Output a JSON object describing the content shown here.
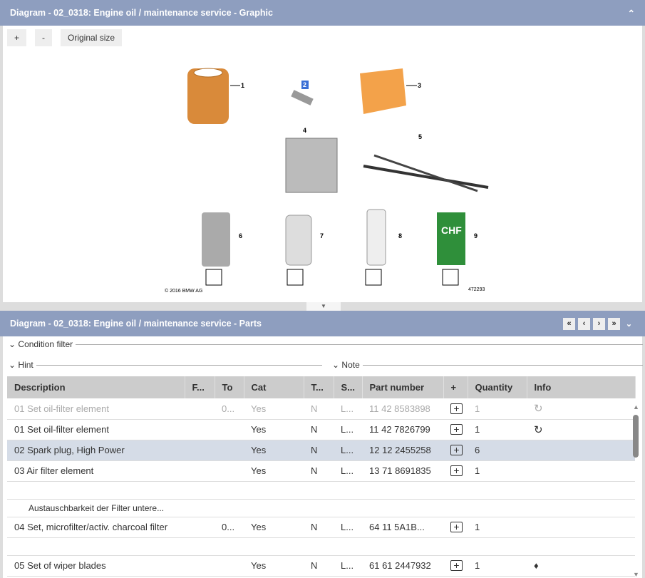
{
  "graphic_panel": {
    "title": "Diagram - 02_0318: Engine oil / maintenance service - Graphic",
    "zoom_in": "+",
    "zoom_out": "-",
    "original_size": "Original size",
    "diagram": {
      "labels": [
        "1",
        "2",
        "3",
        "4",
        "5",
        "6",
        "7",
        "8",
        "9"
      ],
      "copyright": "© 2016 BMW AG",
      "image_id": "472293",
      "product_text": "CHF"
    }
  },
  "parts_panel": {
    "title": "Diagram - 02_0318: Engine oil / maintenance service - Parts",
    "condition_filter": "Condition filter",
    "hint": "Hint",
    "note": "Note",
    "columns": [
      "Description",
      "F...",
      "To",
      "Cat",
      "T...",
      "S...",
      "Part number",
      "+",
      "Quantity",
      "Info"
    ],
    "rows": [
      {
        "desc": "01 Set oil-filter element",
        "f": "",
        "to": "0...",
        "cat": "Yes",
        "t": "N",
        "s": "L...",
        "part": "11 42 8583898",
        "qty": "1",
        "info": "recycle-icon",
        "state": "dim"
      },
      {
        "desc": "01 Set oil-filter element",
        "f": "",
        "to": "",
        "cat": "Yes",
        "t": "N",
        "s": "L...",
        "part": "11 42 7826799",
        "qty": "1",
        "info": "recycle-icon",
        "state": ""
      },
      {
        "desc": "02 Spark plug, High Power",
        "f": "",
        "to": "",
        "cat": "Yes",
        "t": "N",
        "s": "L...",
        "part": "12 12 2455258",
        "qty": "6",
        "info": "",
        "state": "sel"
      },
      {
        "desc": "03 Air filter element",
        "f": "",
        "to": "",
        "cat": "Yes",
        "t": "N",
        "s": "L...",
        "part": "13 71 8691835",
        "qty": "1",
        "info": "",
        "state": ""
      }
    ],
    "hint_row": "Austauschbarkeit der Filter untere...",
    "row4": {
      "desc": "04 Set, microfilter/activ. charcoal filter",
      "to": "0...",
      "cat": "Yes",
      "t": "N",
      "s": "L...",
      "part": "64 11 5A1B...",
      "qty": "1"
    },
    "row5": {
      "desc": "05 Set of wiper blades",
      "cat": "Yes",
      "t": "N",
      "s": "L...",
      "part": "61 61 2447932",
      "qty": "1",
      "info": "grapes-icon"
    }
  }
}
